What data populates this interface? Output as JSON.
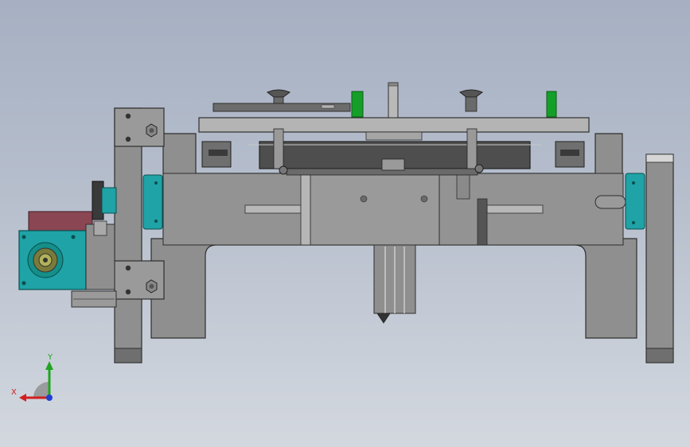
{
  "triad": {
    "x_label": "X",
    "y_label": "Y",
    "x_color": "#d21f1f",
    "y_color": "#1fa51f",
    "z_color": "#1f3fd2"
  },
  "colors": {
    "body_gray": "#8f8f8f",
    "body_edge": "#2e2e2e",
    "plate_light": "#b4b4b4",
    "dark_block": "#4e4e4e",
    "teal": "#1fa3a6",
    "maroon": "#8a4652",
    "green_pin": "#14a028"
  }
}
